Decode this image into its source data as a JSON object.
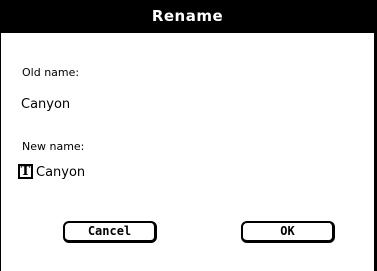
{
  "dialog": {
    "title": "Rename",
    "old_name_label": "Old name:",
    "old_name_value": "Canyon",
    "new_name_label": "New name:",
    "new_name_value": "Canyon",
    "text_field_icon": "text-type-icon",
    "text_field_icon_glyph": "T",
    "cancel_label": "Cancel",
    "ok_label": "OK"
  }
}
